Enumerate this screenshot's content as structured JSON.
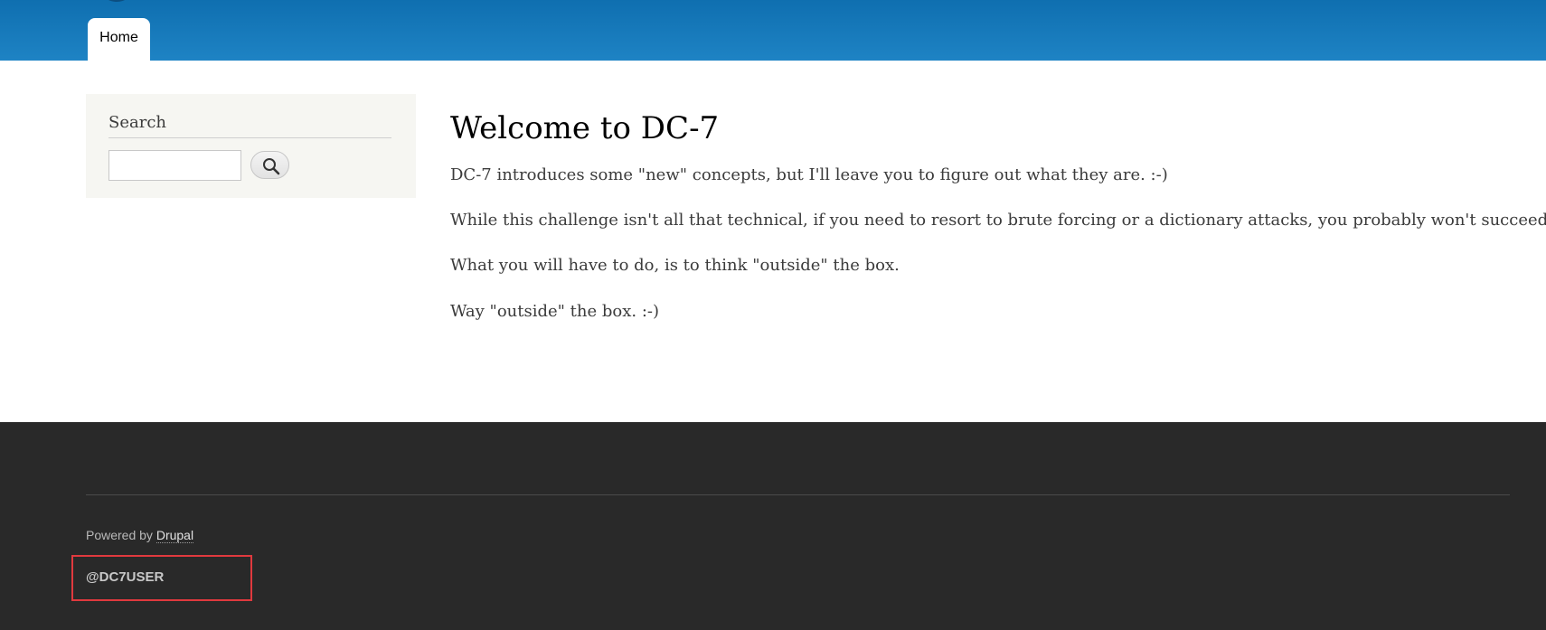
{
  "header": {
    "tabs": [
      {
        "label": "Home",
        "active": true
      }
    ],
    "accent_color": "#1a7fc0"
  },
  "sidebar": {
    "search": {
      "title": "Search",
      "input_value": "",
      "button_icon": "search-icon"
    }
  },
  "main": {
    "title": "Welcome to DC-7",
    "paragraphs": [
      "DC-7 introduces some \"new\" concepts, but I'll leave you to figure out what they are.  :-)",
      "While this challenge isn't all that technical, if you need to resort to brute forcing or a dictionary attacks, you probably won't succeed.",
      "What you will have to do, is to think \"outside\" the box.",
      "Way \"outside\" the box.  :-)"
    ]
  },
  "footer": {
    "powered_by": "Powered by ",
    "powered_link": "Drupal",
    "handle": "@DC7USER",
    "highlight_color": "#e0393e"
  }
}
